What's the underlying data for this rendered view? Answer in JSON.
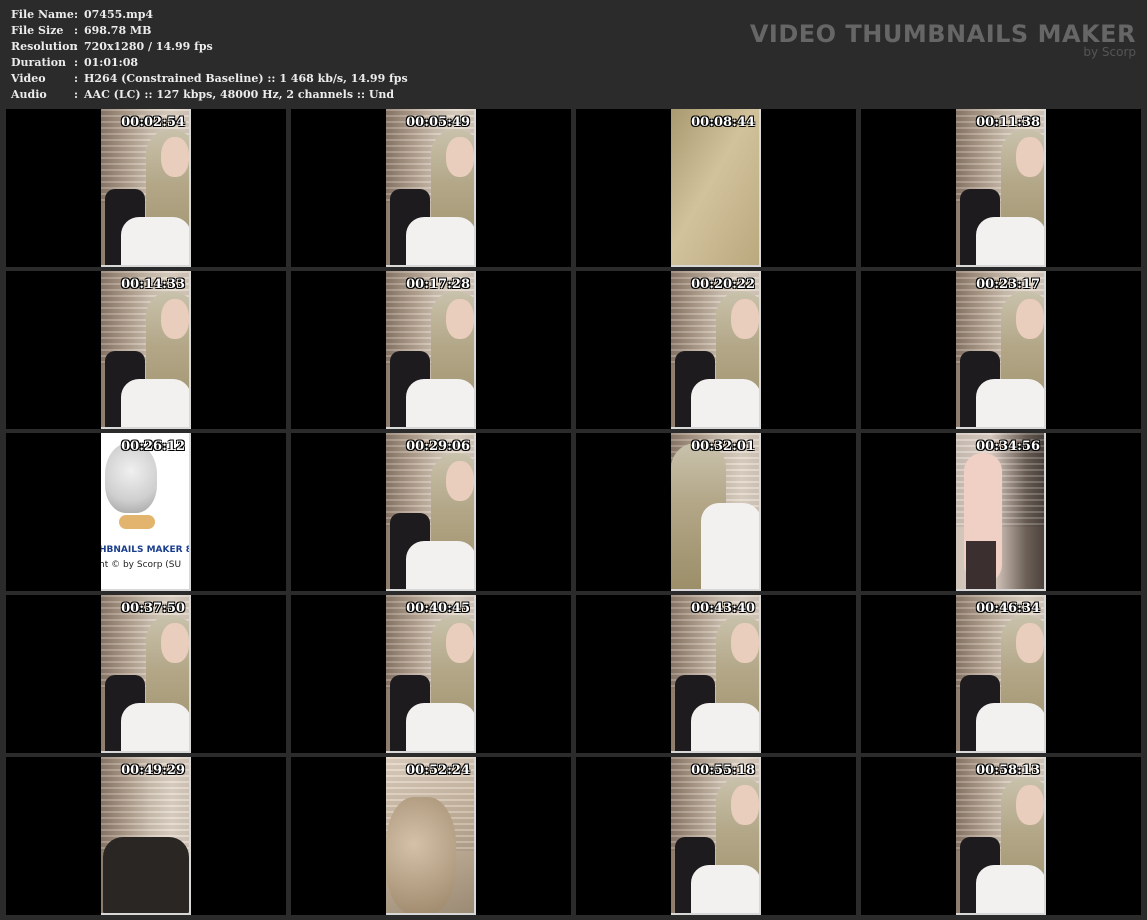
{
  "info": [
    {
      "label": "File Name",
      "sep": ":",
      "value": "07455.mp4"
    },
    {
      "label": "File Size",
      "sep": ":",
      "value": "698.78 MB"
    },
    {
      "label": "Resolution",
      "sep": ":",
      "value": "720x1280 / 14.99 fps"
    },
    {
      "label": "Duration",
      "sep": ":",
      "value": "01:01:08"
    },
    {
      "label": "Video",
      "sep": ":",
      "value": "H264 (Constrained Baseline) :: 1 468 kb/s, 14.99 fps"
    },
    {
      "label": "Audio",
      "sep": ":",
      "value": "AAC (LC) :: 127 kbps, 48000 Hz, 2 channels :: Und"
    }
  ],
  "brand": {
    "title": "VIDEO THUMBNAILS MAKER",
    "subtitle": "by Scorp"
  },
  "logo": {
    "line1": "HBNAILS MAKER 8",
    "line2": "ht © by Scorp (SU"
  },
  "thumbnails": [
    {
      "timestamp": "00:02:54",
      "scene": "seated"
    },
    {
      "timestamp": "00:05:49",
      "scene": "seated"
    },
    {
      "timestamp": "00:08:44",
      "scene": "full"
    },
    {
      "timestamp": "00:11:38",
      "scene": "seated"
    },
    {
      "timestamp": "00:14:33",
      "scene": "seated"
    },
    {
      "timestamp": "00:17:28",
      "scene": "seated"
    },
    {
      "timestamp": "00:20:22",
      "scene": "seated"
    },
    {
      "timestamp": "00:23:17",
      "scene": "seated"
    },
    {
      "timestamp": "00:26:12",
      "scene": "logo"
    },
    {
      "timestamp": "00:29:06",
      "scene": "seated"
    },
    {
      "timestamp": "00:32:01",
      "scene": "side"
    },
    {
      "timestamp": "00:34:56",
      "scene": "legs"
    },
    {
      "timestamp": "00:37:50",
      "scene": "seated"
    },
    {
      "timestamp": "00:40:45",
      "scene": "seated"
    },
    {
      "timestamp": "00:43:40",
      "scene": "seated"
    },
    {
      "timestamp": "00:46:34",
      "scene": "seated"
    },
    {
      "timestamp": "00:49:29",
      "scene": "chair"
    },
    {
      "timestamp": "00:52:24",
      "scene": "blur"
    },
    {
      "timestamp": "00:55:18",
      "scene": "seated"
    },
    {
      "timestamp": "00:58:13",
      "scene": "seated"
    }
  ]
}
